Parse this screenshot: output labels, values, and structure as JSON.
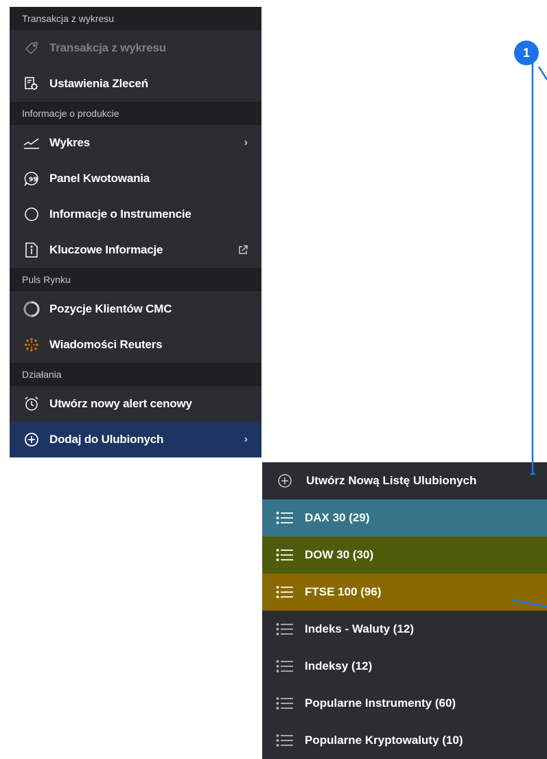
{
  "menu": {
    "sections": [
      {
        "title": "Transakcja z wykresu",
        "items": [
          {
            "label": "Transakcja z wykresu",
            "icon": "tag-icon",
            "disabled": true
          },
          {
            "label": "Ustawienia Zleceń",
            "icon": "order-settings-icon"
          }
        ]
      },
      {
        "title": "Informacje o produkcie",
        "items": [
          {
            "label": "Wykres",
            "icon": "chart-line-icon",
            "trailing": "›"
          },
          {
            "label": "Panel Kwotowania",
            "icon": "quote-panel-icon"
          },
          {
            "label": "Informacje o Instrumencie",
            "icon": "circle-icon"
          },
          {
            "label": "Kluczowe Informacje",
            "icon": "document-info-icon",
            "trailing": "external-link-icon"
          }
        ]
      },
      {
        "title": "Puls Rynku",
        "items": [
          {
            "label": "Pozycje Klientów CMC",
            "icon": "client-sentiment-icon"
          },
          {
            "label": "Wiadomości Reuters",
            "icon": "reuters-icon"
          }
        ]
      },
      {
        "title": "Działania",
        "items": [
          {
            "label": "Utwórz nowy alert cenowy",
            "icon": "alarm-clock-icon"
          },
          {
            "label": "Dodaj do Ulubionych",
            "icon": "plus-circle-icon",
            "trailing": "›",
            "active": true
          }
        ]
      }
    ]
  },
  "submenu": {
    "create_label": "Utwórz Nową Listę Ulubionych",
    "lists": [
      {
        "label": "DAX 30 (29)",
        "color": "#36748a"
      },
      {
        "label": "DOW 30 (30)",
        "color": "#4e5c0c"
      },
      {
        "label": "FTSE 100 (96)",
        "color": "#8a6a00"
      },
      {
        "label": "Indeks - Waluty (12)",
        "color": null
      },
      {
        "label": "Indeksy (12)",
        "color": null
      },
      {
        "label": "Popularne Instrumenty (60)",
        "color": null
      },
      {
        "label": "Popularne Kryptowaluty (10)",
        "color": null
      }
    ]
  },
  "callout": {
    "badge": "1",
    "color": "#1a73e8"
  }
}
